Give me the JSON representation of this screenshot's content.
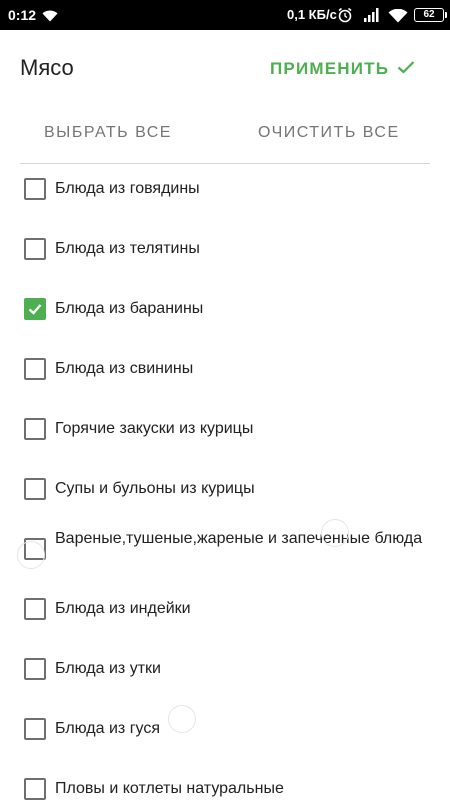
{
  "status_bar": {
    "time": "0:12",
    "network_speed": "0,1 КБ/с",
    "battery": "62",
    "wifi_icon": "wifi-icon",
    "alarm_icon": "alarm-icon",
    "signal_icon": "signal-icon"
  },
  "header": {
    "title": "Мясо",
    "apply_label": "ПРИМЕНИТЬ",
    "apply_icon": "check-icon",
    "accent_color": "#4caf50"
  },
  "actions": {
    "select_all": "ВЫБРАТЬ ВСЕ",
    "clear_all": "ОЧИСТИТЬ ВСЕ"
  },
  "items": [
    {
      "label": "Блюда из говядины",
      "checked": false
    },
    {
      "label": "Блюда из телятины",
      "checked": false
    },
    {
      "label": "Блюда из баранины",
      "checked": true
    },
    {
      "label": "Блюда из свинины",
      "checked": false
    },
    {
      "label": "Горячие закуски из курицы",
      "checked": false
    },
    {
      "label": "Супы и бульоны из курицы",
      "checked": false
    },
    {
      "label": "Вареные,тушеные,жареные и запеченные блюда",
      "checked": false
    },
    {
      "label": "Блюда из индейки",
      "checked": false
    },
    {
      "label": "Блюда из утки",
      "checked": false
    },
    {
      "label": "Блюда из гуся",
      "checked": false
    },
    {
      "label": "Пловы и котлеты натуральные",
      "checked": false
    }
  ]
}
